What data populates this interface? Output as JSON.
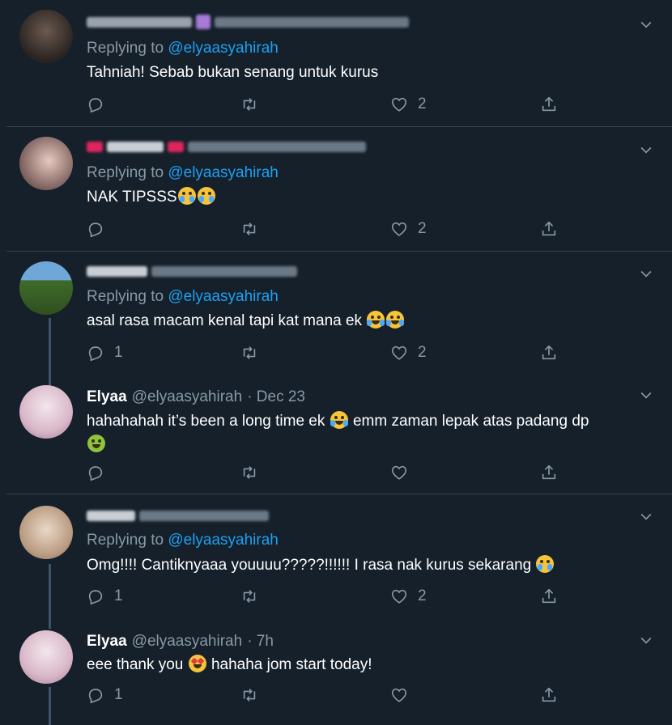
{
  "tweets": [
    {
      "reply_prefix": "Replying to",
      "reply_handle": "@elyaasyahirah",
      "text": "Tahniah! Sebab bukan senang untuk kurus",
      "reply_count": "",
      "like_count": "2"
    },
    {
      "reply_prefix": "Replying to",
      "reply_handle": "@elyaasyahirah",
      "text": "NAK TIPSSS",
      "reply_count": "",
      "like_count": "2"
    },
    {
      "reply_prefix": "Replying to",
      "reply_handle": "@elyaasyahirah",
      "text": "asal rasa macam kenal tapi kat mana ek",
      "reply_count": "1",
      "like_count": "2"
    },
    {
      "name": "Elyaa",
      "handle": "@elyaasyahirah",
      "time": "· Dec 23",
      "text_a": "hahahahah it’s been a long time ek",
      "text_b": "emm zaman lepak atas padang dp",
      "reply_count": "",
      "like_count": ""
    },
    {
      "reply_prefix": "Replying to",
      "reply_handle": "@elyaasyahirah",
      "text": "Omg!!!! Cantiknyaaa youuuu?????!!!!!! I rasa nak kurus sekarang",
      "reply_count": "1",
      "like_count": "2"
    },
    {
      "name": "Elyaa",
      "handle": "@elyaasyahirah",
      "time": "· 7h",
      "text_a": "eee thank you",
      "text_b": "hahaha jom start today!",
      "reply_count": "1",
      "like_count": ""
    }
  ],
  "icons": {
    "reply": "reply-icon",
    "retweet": "retweet-icon",
    "like": "like-icon",
    "share": "share-icon",
    "more": "chevron-down-icon"
  },
  "colors": {
    "background": "#15202b",
    "muted": "#8899a6",
    "link": "#1da1f2",
    "divider": "#38444d"
  }
}
